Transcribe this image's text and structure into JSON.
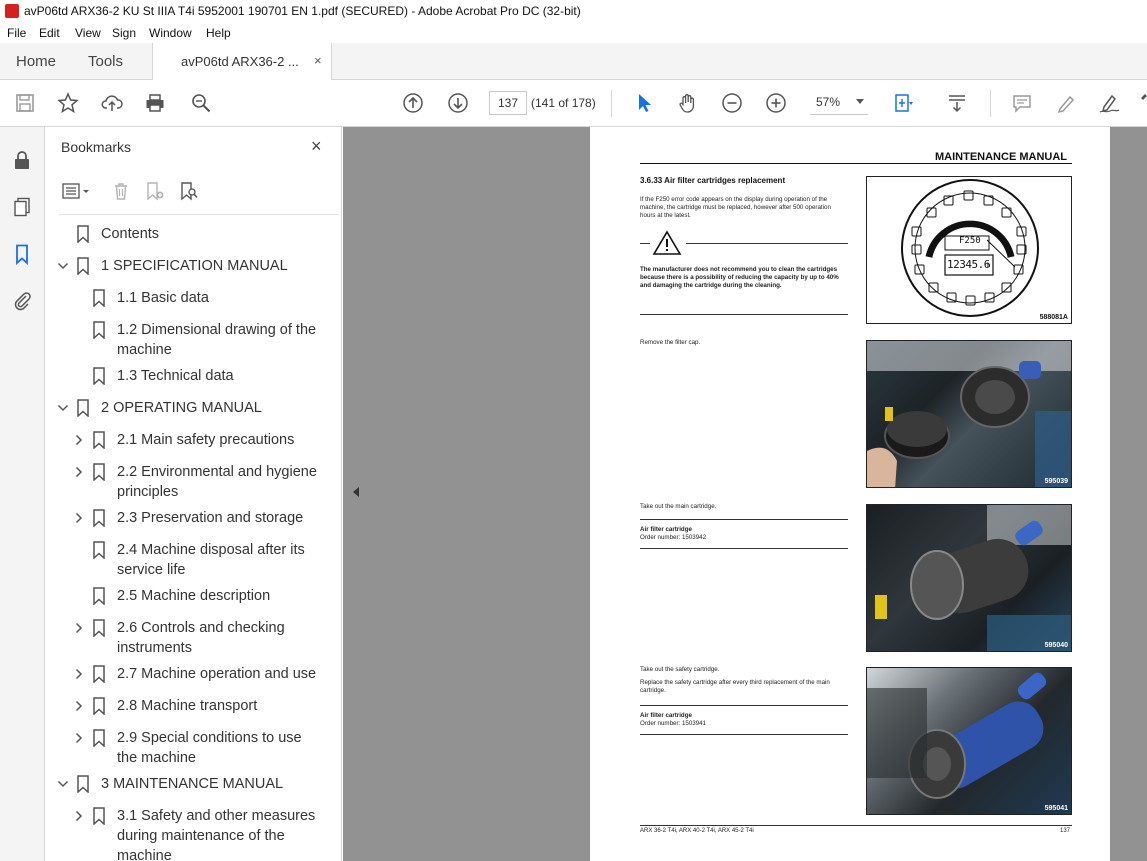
{
  "window": {
    "title": "avP06td ARX36-2 KU St IIIA T4i 5952001 190701 EN 1.pdf (SECURED) - Adobe Acrobat Pro DC (32-bit)"
  },
  "menu": [
    "File",
    "Edit",
    "View",
    "Sign",
    "Window",
    "Help"
  ],
  "tabs": {
    "home": "Home",
    "tools": "Tools",
    "document": "avP06td ARX36-2 ...",
    "close": "×"
  },
  "toolbar": {
    "page_number": "137",
    "page_count": "(141 of 178)",
    "zoom": "57%"
  },
  "bookmarks": {
    "title": "Bookmarks",
    "close": "×",
    "items": [
      {
        "label": "Contents",
        "level": 0,
        "expander": "none"
      },
      {
        "label": "1 SPECIFICATION MANUAL",
        "level": 0,
        "expander": "expanded"
      },
      {
        "label": "1.1 Basic data",
        "level": 1,
        "expander": "none"
      },
      {
        "label": "1.2 Dimensional drawing of the machine",
        "level": 1,
        "expander": "none"
      },
      {
        "label": "1.3 Technical data",
        "level": 1,
        "expander": "none"
      },
      {
        "label": "2 OPERATING MANUAL",
        "level": 0,
        "expander": "expanded"
      },
      {
        "label": "2.1 Main safety precautions",
        "level": 1,
        "expander": "collapsed"
      },
      {
        "label": "2.2 Environmental and hygiene principles",
        "level": 1,
        "expander": "collapsed"
      },
      {
        "label": "2.3 Preservation and storage",
        "level": 1,
        "expander": "collapsed"
      },
      {
        "label": "2.4 Machine disposal after its service life",
        "level": 1,
        "expander": "none"
      },
      {
        "label": "2.5 Machine description",
        "level": 1,
        "expander": "none"
      },
      {
        "label": "2.6 Controls and checking instruments",
        "level": 1,
        "expander": "collapsed"
      },
      {
        "label": "2.7 Machine operation and use",
        "level": 1,
        "expander": "collapsed"
      },
      {
        "label": "2.8 Machine transport",
        "level": 1,
        "expander": "collapsed"
      },
      {
        "label": "2.9 Special conditions to use the machine",
        "level": 1,
        "expander": "collapsed"
      },
      {
        "label": "3 MAINTENANCE MANUAL",
        "level": 0,
        "expander": "expanded"
      },
      {
        "label": "3.1 Safety and other measures during maintenance of the machine",
        "level": 1,
        "expander": "collapsed"
      }
    ]
  },
  "page": {
    "header": "MAINTENANCE MANUAL",
    "section_title": "3.6.33   Air filter cartridges replacement",
    "intro": "If the F250 error code appears on the display during operation of the machine, the cartridge must be replaced, however after 500 operation hours at the latest.",
    "warning": "The manufacturer does not recommend you to clean the cartridges because there is a possibility of reducing the capacity by up to 40% and damaging the cartridge during the cleaning.",
    "step1": "Remove the filter cap.",
    "step2": "Take out the main cartridge.",
    "part1_name": "Air filter cartridge",
    "part1_order": "Order number: 1503942",
    "step3a": "Take out the safety cartridge.",
    "step3b": "Replace the safety cartridge after every third replacement of the main cartridge.",
    "part2_name": "Air filter cartridge",
    "part2_order": "Order number: 1503941",
    "fig1_code": "588081A",
    "fig1_display_code": "F250",
    "fig1_display_hours": "12345.6",
    "fig1_display_unit": "h",
    "fig2_code": "595039",
    "fig3_code": "595040",
    "fig4_code": "595041",
    "footer": "ARX 36-2 T4i, ARX 40-2 T4i, ARX 45-2 T4i",
    "page_num": "137"
  }
}
